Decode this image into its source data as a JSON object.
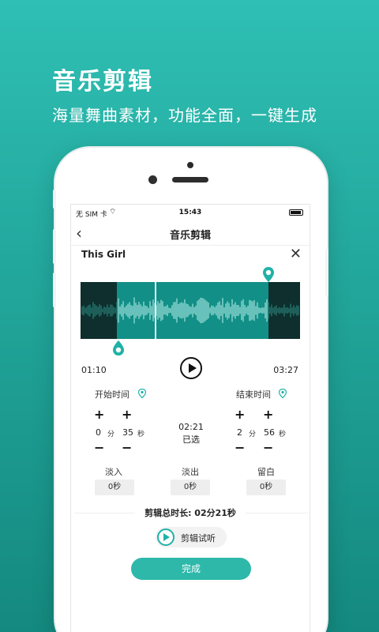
{
  "promo": {
    "headline": "音乐剪辑",
    "subline": "海量舞曲素材，功能全面，一键生成"
  },
  "status_bar": {
    "carrier": "无 SIM 卡",
    "time": "15:43"
  },
  "nav": {
    "title": "音乐剪辑"
  },
  "track": {
    "title": "This Girl",
    "start_time": "01:10",
    "end_time": "03:27"
  },
  "start": {
    "label": "开始时间",
    "minutes": "0",
    "minutes_unit": "分",
    "seconds": "35",
    "seconds_unit": "秒"
  },
  "end": {
    "label": "结束时间",
    "minutes": "2",
    "minutes_unit": "分",
    "seconds": "56",
    "seconds_unit": "秒"
  },
  "selection": {
    "duration": "02:21",
    "label": "已选"
  },
  "effects": {
    "fade_in_label": "淡入",
    "fade_in_value": "0秒",
    "fade_out_label": "淡出",
    "fade_out_value": "0秒",
    "silence_label": "留白",
    "silence_value": "0秒"
  },
  "total": {
    "text": "剪辑总时长: 02分21秒"
  },
  "preview": {
    "label": "剪辑试听"
  },
  "done": {
    "label": "完成"
  },
  "colors": {
    "accent": "#2db8aa",
    "waveform_bg": "#0e2f2d",
    "waveform_selected": "#128f86"
  }
}
